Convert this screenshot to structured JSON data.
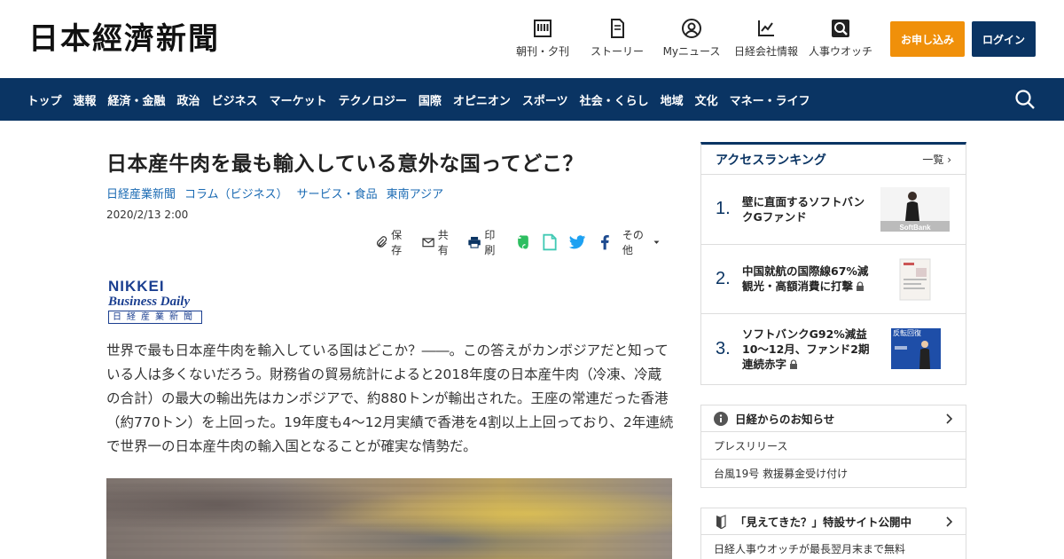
{
  "header": {
    "logo": "日本經濟新聞",
    "nav": [
      {
        "label": "朝刊・夕刊",
        "icon": "newspaper-icon"
      },
      {
        "label": "ストーリー",
        "icon": "document-icon"
      },
      {
        "label": "Myニュース",
        "icon": "user-icon"
      },
      {
        "label": "日経会社情報",
        "icon": "chart-icon"
      },
      {
        "label": "人事ウオッチ",
        "icon": "search-person-icon"
      }
    ],
    "apply_label": "お申し込み",
    "login_label": "ログイン"
  },
  "mainnav": {
    "items": [
      "トップ",
      "速報",
      "経済・金融",
      "政治",
      "ビジネス",
      "マーケット",
      "テクノロジー",
      "国際",
      "オピニオン",
      "スポーツ",
      "社会・くらし",
      "地域",
      "文化",
      "マネー・ライフ"
    ]
  },
  "article": {
    "title": "日本産牛肉を最も輸入している意外な国ってどこ？",
    "tags": [
      "日経産業新聞",
      "コラム（ビジネス）",
      "サービス・食品",
      "東南アジア"
    ],
    "date": "2020/2/13 2:00",
    "share": {
      "save": "保存",
      "share": "共有",
      "print": "印刷",
      "more": "その他"
    },
    "source_logo": {
      "line1": "NIKKEI",
      "line2": "Business Daily",
      "line3": "日経産業新聞"
    },
    "body": "世界で最も日本産牛肉を輸入している国はどこか？――。この答えがカンボジアだと知っている人は多くないだろう。財務省の貿易統計によると2018年度の日本産牛肉（冷凍、冷蔵の合計）の最大の輸出先はカンボジアで、約880トンが輸出された。王座の常連だった香港（約770トン）を上回った。19年度も4～12月実績で香港を4割以上上回っており、2年連続で世界一の日本産牛肉の輸入国となることが確実な情勢だ。"
  },
  "ranking": {
    "title": "アクセスランキング",
    "more": "一覧",
    "items": [
      {
        "num": "1.",
        "text": "壁に直面するソフトバンクGファンド",
        "locked": false,
        "thumb_text": "SoftBank"
      },
      {
        "num": "2.",
        "text": "中国就航の国際線67%減 観光・高額消費に打撃",
        "locked": true,
        "thumb_text": ""
      },
      {
        "num": "3.",
        "text": "ソフトバンクG92%減益 10～12月、ファンド2期連続赤字",
        "locked": true,
        "thumb_text": "反転回復"
      }
    ]
  },
  "notice": {
    "title": "日経からのお知らせ",
    "rows": [
      "プレスリリース",
      "台風19号 救援募金受け付け"
    ]
  },
  "feature": {
    "title": "「見えてきた？」特設サイト公開中",
    "rows": [
      "日経人事ウオッチが最長翌月末まで無料"
    ]
  },
  "colors": {
    "navy": "#0a3463",
    "orange": "#f0900a",
    "link": "#1a6ab3"
  }
}
